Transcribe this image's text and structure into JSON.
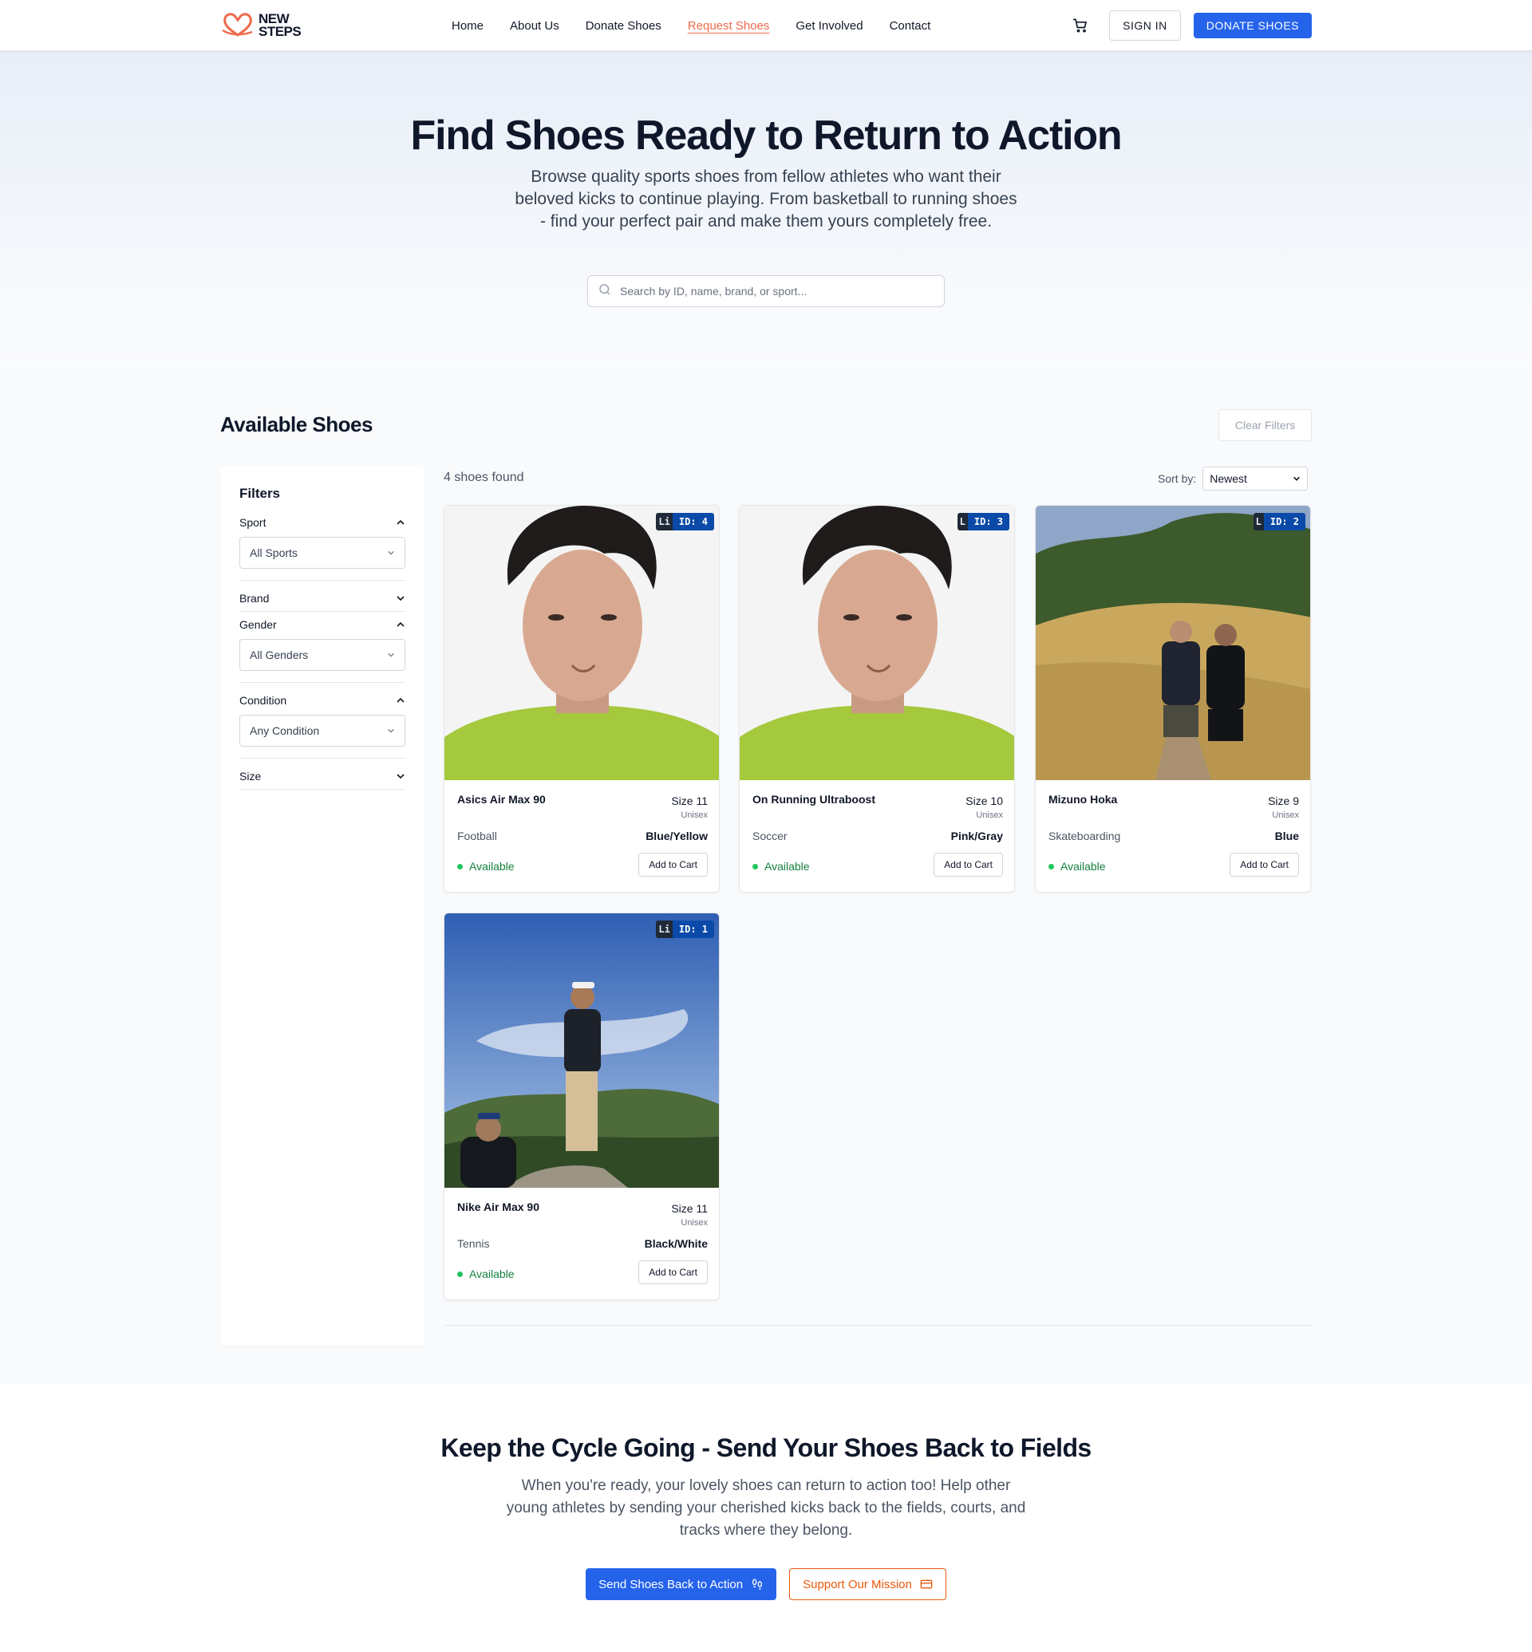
{
  "nav": {
    "logo_line1": "NEW",
    "logo_line2": "STEPS",
    "links": [
      "Home",
      "About Us",
      "Donate Shoes",
      "Request Shoes",
      "Get Involved",
      "Contact"
    ],
    "active_link": "Request Shoes",
    "cart_icon": "cart-icon",
    "sign_in": "SIGN IN",
    "donate": "DONATE SHOES"
  },
  "hero": {
    "title": "Find Shoes Ready to Return to Action",
    "subtitle": "Browse quality sports shoes from fellow athletes who want their beloved kicks to continue playing. From basketball to running shoes - find your perfect pair and make them yours completely free.",
    "search_placeholder": "Search by ID, name, brand, or sport..."
  },
  "listing": {
    "title": "Available Shoes",
    "clear_filters": "Clear Filters",
    "count_text": "4 shoes found",
    "sort_label": "Sort by:",
    "sort_value": "Newest"
  },
  "filters": {
    "title": "Filters",
    "groups": [
      {
        "label": "Sport",
        "expanded": true,
        "value": "All Sports"
      },
      {
        "label": "Brand",
        "expanded": false
      },
      {
        "label": "Gender",
        "expanded": true,
        "value": "All Genders"
      },
      {
        "label": "Condition",
        "expanded": true,
        "value": "Any Condition"
      },
      {
        "label": "Size",
        "expanded": false
      }
    ]
  },
  "shoes": [
    {
      "id": "ID: 4",
      "badge_prefix": "Li",
      "name": "Asics Air Max 90",
      "size": "Size 11",
      "gender": "Unisex",
      "sport": "Football",
      "color": "Blue/Yellow",
      "status": "Available",
      "add": "Add to Cart"
    },
    {
      "id": "ID: 3",
      "badge_prefix": "L",
      "name": "On Running Ultraboost",
      "size": "Size 10",
      "gender": "Unisex",
      "sport": "Soccer",
      "color": "Pink/Gray",
      "status": "Available",
      "add": "Add to Cart"
    },
    {
      "id": "ID: 2",
      "badge_prefix": "L",
      "name": "Mizuno Hoka",
      "size": "Size 9",
      "gender": "Unisex",
      "sport": "Skateboarding",
      "color": "Blue",
      "status": "Available",
      "add": "Add to Cart"
    },
    {
      "id": "ID: 1",
      "badge_prefix": "Li",
      "name": "Nike Air Max 90",
      "size": "Size 11",
      "gender": "Unisex",
      "sport": "Tennis",
      "color": "Black/White",
      "status": "Available",
      "add": "Add to Cart"
    }
  ],
  "cta": {
    "title": "Keep the Cycle Going - Send Your Shoes Back to Fields",
    "text": "When you're ready, your lovely shoes can return to action too! Help other young athletes by sending your cherished kicks back to the fields, courts, and tracks where they belong.",
    "primary": "Send Shoes Back to Action",
    "secondary": "Support Our Mission"
  },
  "colors": {
    "primary": "#2563eb",
    "accent": "#ef6a4b",
    "available": "#15803d"
  }
}
